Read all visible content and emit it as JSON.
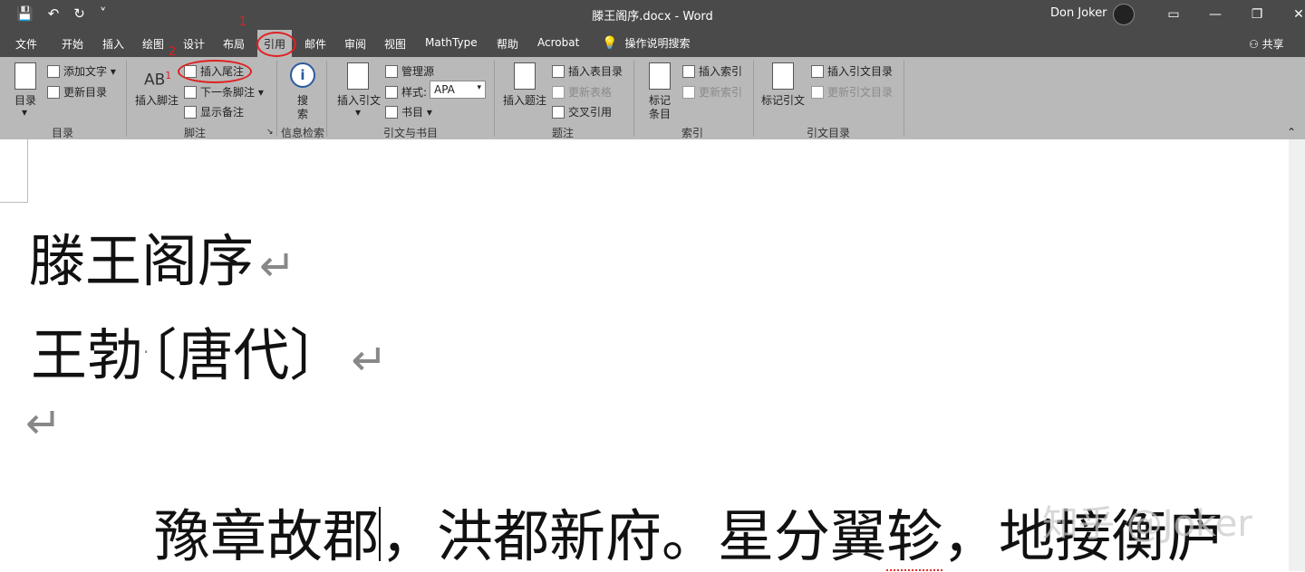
{
  "window": {
    "title": "滕王阁序.docx  -  Word",
    "user": "Don Joker",
    "qat": [
      "💾",
      "↶",
      "↻",
      "˅"
    ],
    "controls": [
      "▭",
      "—",
      "❐",
      "✕"
    ]
  },
  "menu": {
    "tabs": [
      "文件",
      "开始",
      "插入",
      "绘图",
      "设计",
      "布局",
      "引用",
      "邮件",
      "审阅",
      "视图",
      "MathType",
      "帮助",
      "Acrobat"
    ],
    "active": "引用",
    "help_text": "操作说明搜索",
    "share": "共享"
  },
  "annotations": {
    "mark1": "1",
    "mark2": "2"
  },
  "ribbon": {
    "toc": {
      "big": "目录",
      "add_text": "添加文字",
      "update": "更新目录",
      "group": "目录"
    },
    "footnote": {
      "big": "插入脚注",
      "endnote": "插入尾注",
      "next": "下一条脚注",
      "show": "显示备注",
      "group": "脚注",
      "ab": "AB",
      "sup": "1"
    },
    "research": {
      "big_top": "搜",
      "big_bottom": "索",
      "group": "信息检索"
    },
    "citations": {
      "big": "插入引文",
      "manage": "管理源",
      "style_label": "样式:",
      "style_value": "APA",
      "biblio": "书目",
      "group": "引文与书目"
    },
    "captions": {
      "big": "插入题注",
      "table_figs": "插入表目录",
      "update": "更新表格",
      "cross_ref": "交叉引用",
      "group": "题注"
    },
    "index": {
      "big_top": "标记",
      "big_bottom": "条目",
      "insert": "插入索引",
      "update": "更新索引",
      "group": "索引"
    },
    "authorities": {
      "big": "标记引文",
      "insert": "插入引文目录",
      "update": "更新引文目录",
      "group": "引文目录"
    }
  },
  "document": {
    "title": "滕王阁序",
    "author": "王勃",
    "dynasty": "〔唐代〕",
    "para_part1": "豫章故郡",
    "para_part2": "，洪都新府。星分翼",
    "para_squiggle": "轸",
    "para_part3": "，地接衡庐",
    "pilcrow": "↵",
    "watermark": "知乎 @Joker"
  },
  "colors": {
    "chrome": "#4a4a4a",
    "ribbon": "#b9b9b9",
    "annotation": "#e02020"
  }
}
